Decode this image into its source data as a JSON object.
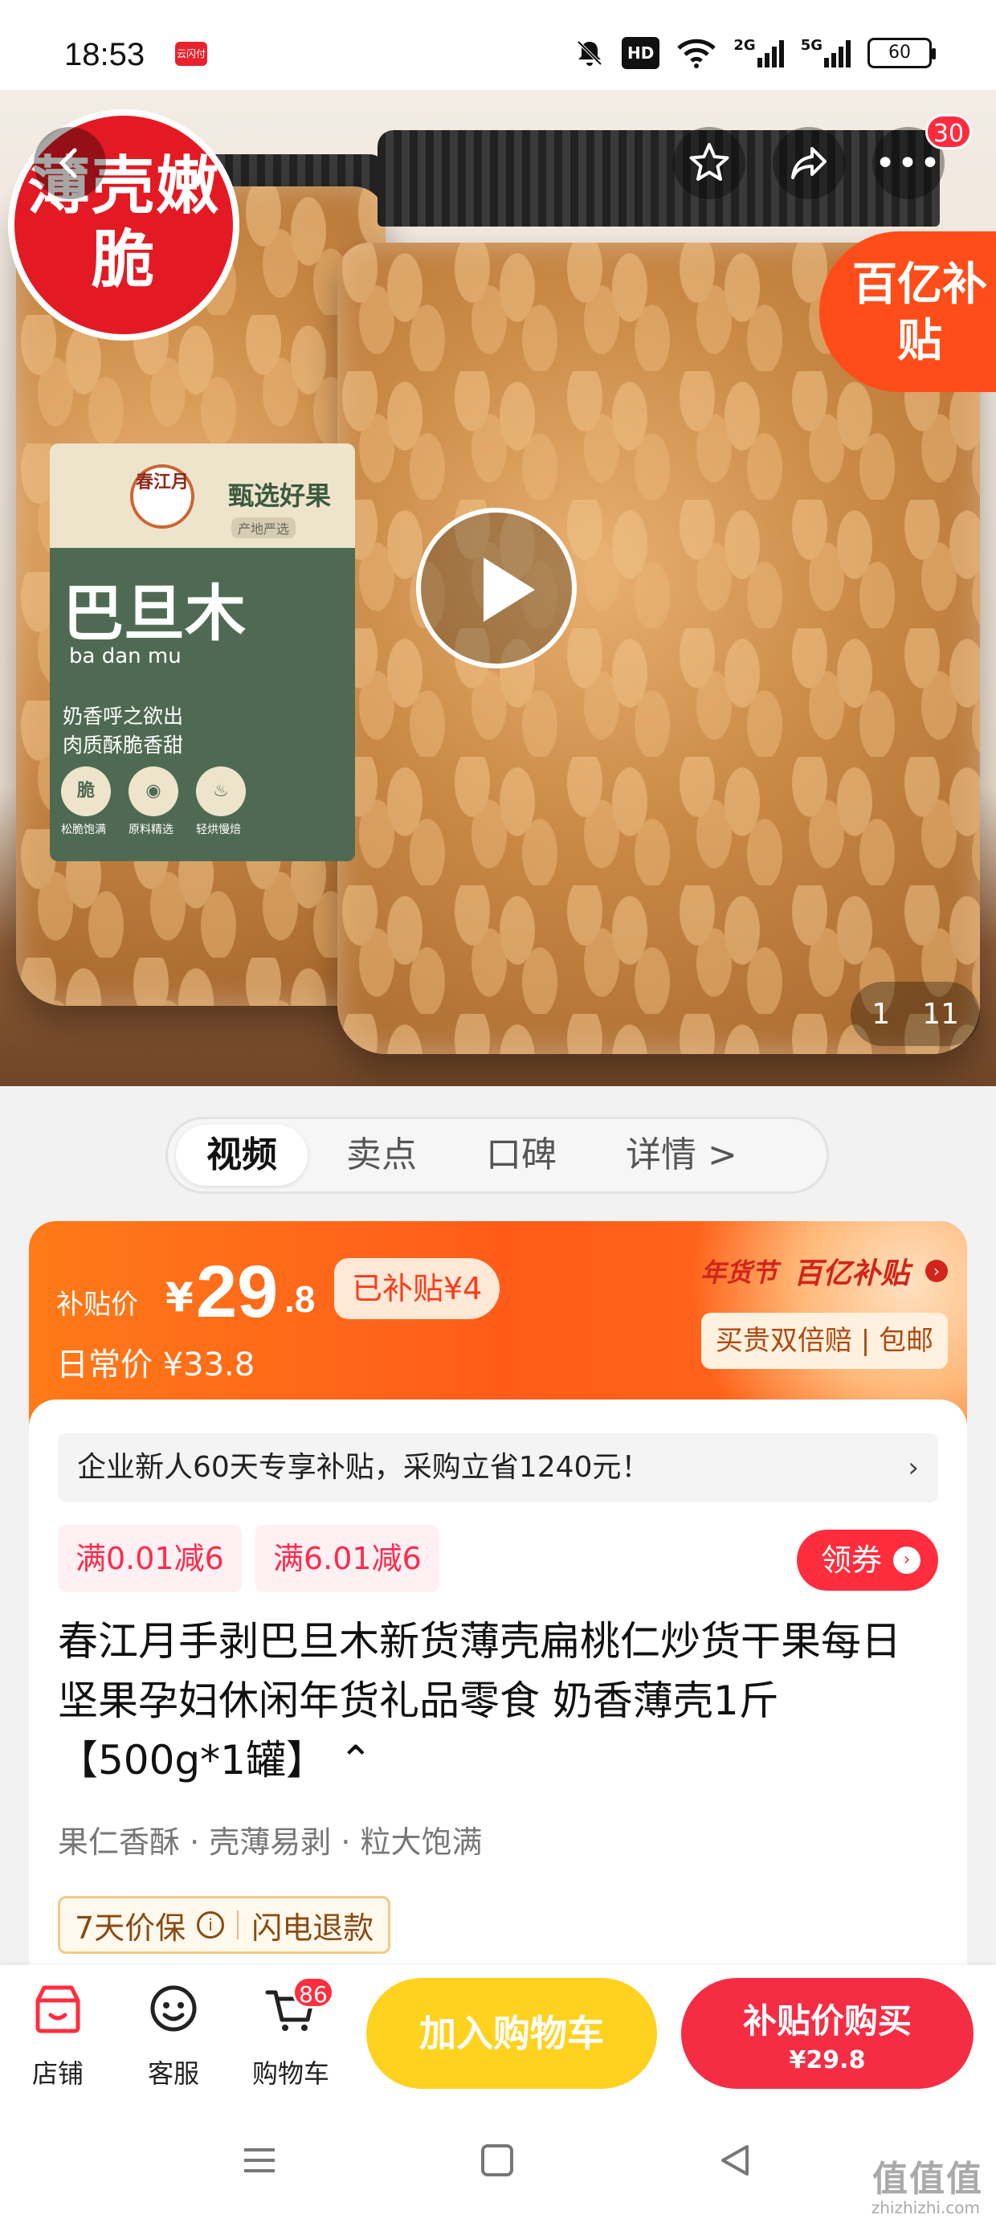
{
  "status": {
    "time": "18:53",
    "app_icon": "云闪付",
    "hd_label": "HD",
    "network_2g": "2G",
    "network_5g": "5G",
    "battery": "60"
  },
  "hero": {
    "promo_badge": "薄壳嫩脆",
    "subsidy_corner": "百亿补贴",
    "more_badge": "30",
    "page_current": "1",
    "page_total": "11",
    "label": {
      "logo": "春江月",
      "select": "甄选好果",
      "select_sub": "产地严选",
      "name": "巴旦木",
      "pinyin": "ba dan mu",
      "desc_1": "奶香呼之欲出",
      "desc_2": "肉质酥脆香甜",
      "badge_1": "脆",
      "badge_1_caption": "松脆饱满",
      "badge_2_caption": "原料精选",
      "badge_3_caption": "轻烘慢焙"
    }
  },
  "tabs": [
    {
      "label": "视频",
      "active": true
    },
    {
      "label": "卖点"
    },
    {
      "label": "口碑"
    },
    {
      "label": "详情 >"
    }
  ],
  "price": {
    "label": "补贴价",
    "currency": "¥",
    "integer": "29",
    "decimal": ".8",
    "subsidized": "已补贴¥4",
    "daily": "日常价 ¥33.8",
    "event": "年货节",
    "event_sub": "百亿补贴",
    "guarantee": "买贵双倍赔 | 包邮"
  },
  "detail": {
    "banner": "企业新人60天专享补贴，采购立省1240元！",
    "coupons": [
      "满0.01减6",
      "满6.01减6"
    ],
    "claim": "领券",
    "title": "春江月手剥巴旦木新货薄壳扁桃仁炒货干果每日坚果孕妇休闲年货礼品零食 奶香薄壳1斤【500g*1罐】 ⌃",
    "features": "果仁香酥 · 壳薄易剥 · 粒大饱满",
    "service_1": "7天价保",
    "service_2": "闪电退款"
  },
  "bottom": {
    "store": "店铺",
    "service": "客服",
    "cart": "购物车",
    "cart_badge": "86",
    "add_cart": "加入购物车",
    "buy_label": "补贴价购买",
    "buy_price": "¥29.8"
  },
  "watermark": "值值值",
  "watermark_sub": "zhizhizhi.com"
}
